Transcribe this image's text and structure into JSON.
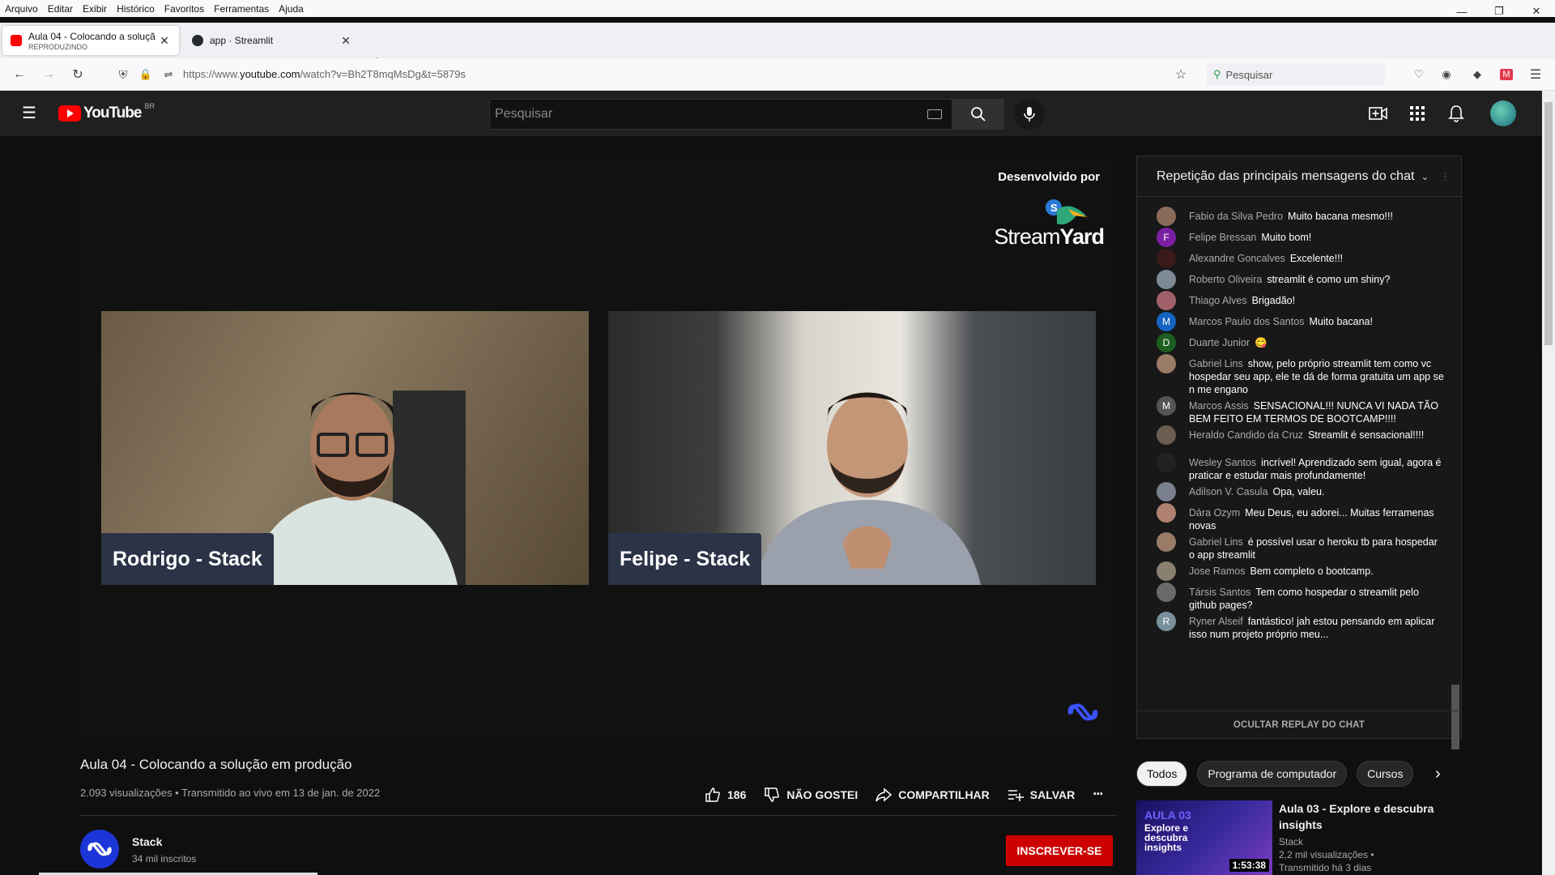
{
  "menubar": [
    "Arquivo",
    "Editar",
    "Exibir",
    "Histórico",
    "Favoritos",
    "Ferramentas",
    "Ajuda"
  ],
  "tabs": [
    {
      "title": "Aula 04 - Colocando a soluçã",
      "subtitle": "REPRODUZINDO"
    },
    {
      "title": "app · Streamlit"
    }
  ],
  "url": {
    "prefix": "https://www.",
    "domain": "youtube.com",
    "path": "/watch?v=Bh2T8mqMsDg&t=5879s"
  },
  "firefox_search": "Pesquisar",
  "youtube": {
    "logo": "YouTube",
    "country": "BR",
    "search_placeholder": "Pesquisar"
  },
  "video": {
    "credit": "Desenvolvido por",
    "brand_a": "Stream",
    "brand_b": "Yard",
    "cam1_name": "Rodrigo - Stack",
    "cam2_name": "Felipe - Stack"
  },
  "info": {
    "title": "Aula 04 - Colocando a solução em produção",
    "meta": "2.093 visualizações • Transmitido ao vivo em 13 de jan. de 2022",
    "likes": "186",
    "dislike": "NÃO GOSTEI",
    "share": "COMPARTILHAR",
    "save": "SALVAR",
    "more": "···"
  },
  "channel": {
    "name": "Stack",
    "subs": "34 mil inscritos",
    "subscribe": "INSCREVER-SE"
  },
  "chat": {
    "header": "Repetição das principais mensagens do chat",
    "hide": "OCULTAR REPLAY DO CHAT",
    "messages": [
      {
        "author": "Fabio da Silva Pedro",
        "text": "Muito bacana mesmo!!!",
        "avatar": "",
        "color": "#8a6b5a"
      },
      {
        "author": "Felipe Bressan",
        "text": "Muito bom!",
        "avatar": "F",
        "color": "#7b1fa2"
      },
      {
        "author": "Alexandre Goncalves",
        "text": "Excelente!!!",
        "avatar": "",
        "color": "#3a1a1a"
      },
      {
        "author": "Roberto Oliveira",
        "text": "streamlit é como um shiny?",
        "avatar": "",
        "color": "#7d8a96"
      },
      {
        "author": "Thiago Alves",
        "text": "Brigadão!",
        "avatar": "",
        "color": "#a0606a"
      },
      {
        "author": "Marcos Paulo dos Santos",
        "text": "Muito bacana!",
        "avatar": "M",
        "color": "#1565c0"
      },
      {
        "author": "Duarte Junior",
        "text": "😋",
        "avatar": "D",
        "color": "#1b5e20"
      },
      {
        "author": "Gabriel Lins",
        "text": "show, pelo próprio streamlit tem como vc hospedar seu app, ele te dá de forma gratuita um app se n me engano",
        "avatar": "",
        "color": "#9a7b66"
      },
      {
        "author": "Marcos Assis",
        "text": "SENSACIONAL!!! NUNCA VI NADA TÃO BEM FEITO EM TERMOS DE BOOTCAMP!!!!",
        "avatar": "M",
        "color": "#555"
      },
      {
        "author": "Heraldo Candido da Cruz",
        "text": "Streamlit é sensacional!!!!",
        "avatar": "",
        "color": "#6b5d50"
      },
      {
        "author": "Wesley Santos",
        "text": "incrível! Aprendizado sem igual, agora é praticar e estudar mais profundamente!",
        "avatar": "",
        "color": "#222"
      },
      {
        "author": "Adilson V. Casula",
        "text": "Opa, valeu.",
        "avatar": "",
        "color": "#7a8090"
      },
      {
        "author": "Dára Ozym",
        "text": "Meu Deus, eu adorei... Muitas ferramenas novas",
        "avatar": "",
        "color": "#b08070"
      },
      {
        "author": "Gabriel Lins",
        "text": "é possível usar o heroku tb para hospedar o app streamlit",
        "avatar": "",
        "color": "#9a7b66"
      },
      {
        "author": "Jose Ramos",
        "text": "Bem completo o bootcamp.",
        "avatar": "",
        "color": "#8a8070"
      },
      {
        "author": "Társis Santos",
        "text": "Tem como hospedar o streamlit pelo github pages?",
        "avatar": "",
        "color": "#6a6a6a"
      },
      {
        "author": "Ryner Alseif",
        "text": "fantástico! jah estou pensando em aplicar isso num projeto próprio meu...",
        "avatar": "R",
        "color": "#78909c"
      }
    ]
  },
  "chips": [
    "Todos",
    "Programa de computador",
    "Cursos"
  ],
  "recommended": {
    "thumb_num": "AULA 03",
    "thumb_text": "Explore e descubra insights",
    "duration": "1:53:38",
    "title": "Aula 03 - Explore e descubra insights",
    "channel": "Stack",
    "views": "2,2 mil visualizações •",
    "when": "Transmitido há 3 dias"
  },
  "colors": {
    "youtube_red": "#ff0000",
    "subscribe": "#cc0000",
    "stack_blue": "#1c35d8"
  }
}
